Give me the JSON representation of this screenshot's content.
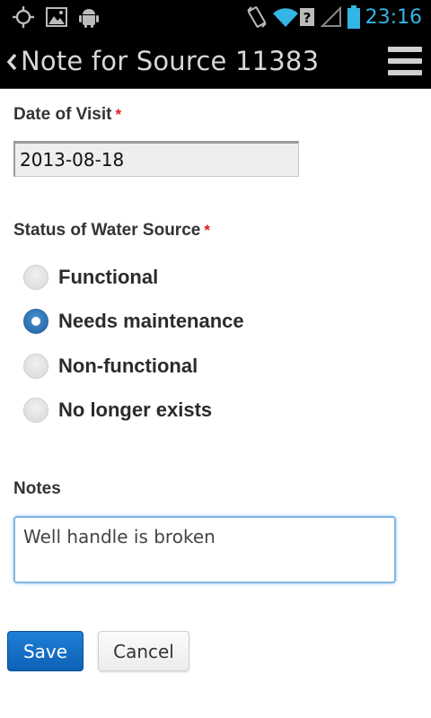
{
  "status_bar": {
    "time": "23:16",
    "accent_color": "#33b5e5",
    "icons": [
      "gps-icon",
      "image-icon",
      "android-icon",
      "vibrate-icon",
      "wifi-icon",
      "signal-icon",
      "battery-icon"
    ]
  },
  "header": {
    "title": "Note for Source 11383",
    "back_icon": "chevron-left-icon",
    "menu_icon": "menu-icon"
  },
  "form": {
    "date_label": "Date of Visit",
    "date_required": "*",
    "date_value": "2013-08-18",
    "status_label": "Status of Water Source",
    "status_required": "*",
    "status_options": [
      {
        "label": "Functional",
        "selected": false
      },
      {
        "label": "Needs maintenance",
        "selected": true
      },
      {
        "label": "Non-functional",
        "selected": false
      },
      {
        "label": "No longer exists",
        "selected": false
      }
    ],
    "notes_label": "Notes",
    "notes_value": "Well handle is broken"
  },
  "actions": {
    "save_label": "Save",
    "cancel_label": "Cancel",
    "save_color": "#1170c8"
  }
}
